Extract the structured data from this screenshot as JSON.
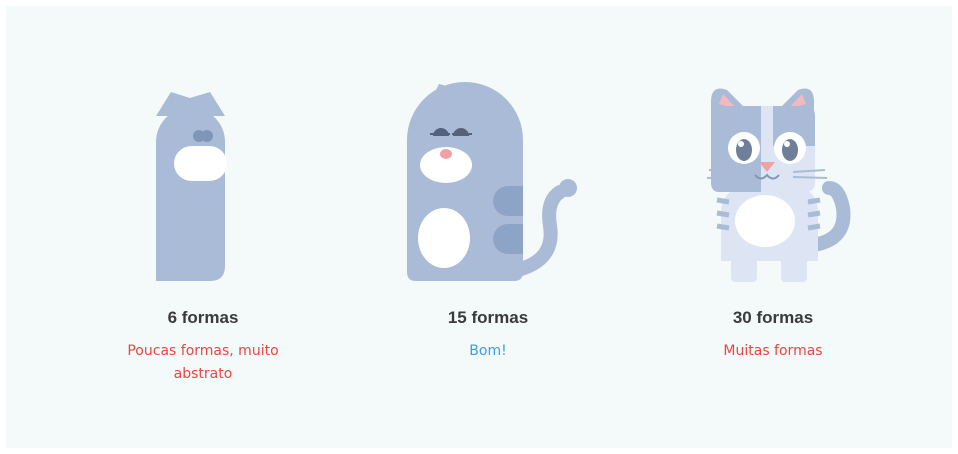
{
  "colors": {
    "background": "#f4f9f9",
    "body": "#a9bbd6",
    "dark": "#7f96b8",
    "light": "#dde5f4",
    "white": "#ffffff",
    "nose": "#f1a0a6",
    "title": "#3a3a3a",
    "warning": "#ee4444",
    "ok": "#3a9ee8"
  },
  "cards": [
    {
      "title": "6 formas",
      "note": "Poucas formas, muito abstrato",
      "note_color": "#ee4444",
      "illustration": "cat-6-shapes-icon"
    },
    {
      "title": "15 formas",
      "note": "Bom!",
      "note_color": "#3a9ee8",
      "illustration": "cat-15-shapes-icon"
    },
    {
      "title": "30 formas",
      "note": "Muitas formas",
      "note_color": "#ee4444",
      "illustration": "cat-30-shapes-icon"
    }
  ]
}
